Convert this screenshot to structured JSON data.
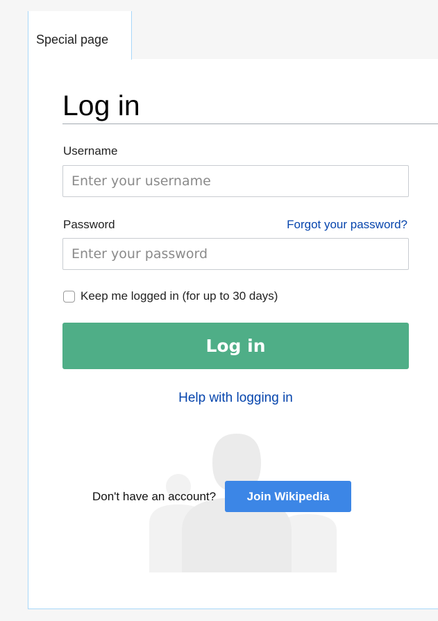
{
  "tab": {
    "label": "Special page"
  },
  "page": {
    "title": "Log in"
  },
  "form": {
    "username": {
      "label": "Username",
      "placeholder": "Enter your username",
      "value": ""
    },
    "password": {
      "label": "Password",
      "placeholder": "Enter your password",
      "value": "",
      "forgot_link": "Forgot your password?"
    },
    "remember_me": {
      "label": "Keep me logged in (for up to 30 days)",
      "checked": false
    },
    "submit_label": "Log in",
    "help_link": "Help with logging in"
  },
  "signup": {
    "prompt": "Don't have an account?",
    "button_label": "Join Wikipedia"
  },
  "colors": {
    "login_button": "#4fae87",
    "join_button": "#3c86e6",
    "link": "#0645ad",
    "tab_border": "#a7d7f9",
    "silhouette": "#eeeeee"
  },
  "icons": {
    "background_illustration": "people-silhouette-icon",
    "checkbox": "checkbox-unchecked-icon"
  }
}
